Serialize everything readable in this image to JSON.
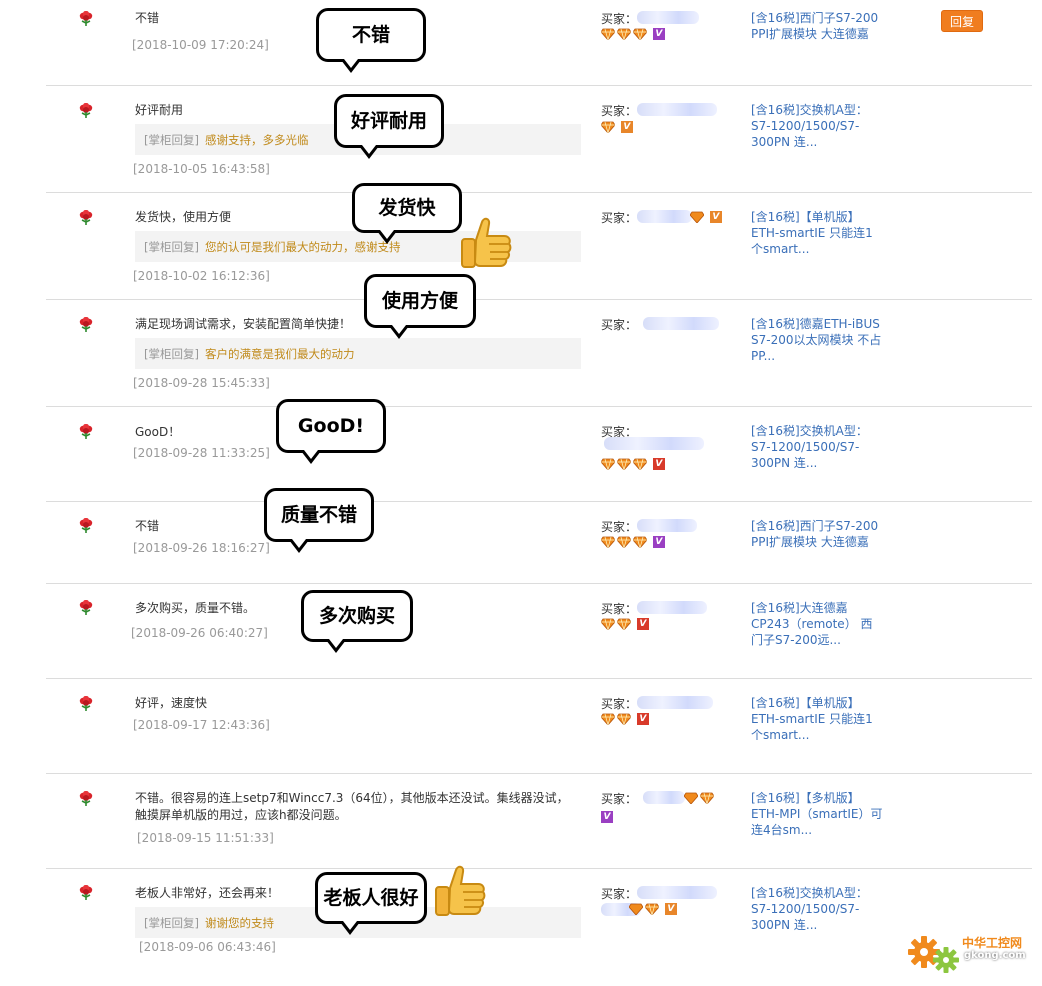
{
  "reviews": [
    {
      "comment": "不错",
      "reply_prefix": "",
      "reply_text": "",
      "date": "[2018-10-09 17:20:24]",
      "buyer_label": "买家：",
      "product": "[含16税]西门子S7-200 PPI扩展模块 大连德嘉",
      "has_reply_button": true,
      "reply_button_label": "回复"
    },
    {
      "comment": "好评耐用",
      "reply_prefix": "[掌柜回复]",
      "reply_text": "感谢支持，多多光临",
      "date": "[2018-10-05 16:43:58]",
      "buyer_label": "买家：",
      "product": "[含16税]交换机A型：S7-1200/1500/S7-300PN 连..."
    },
    {
      "comment": "发货快，使用方便",
      "reply_prefix": "[掌柜回复]",
      "reply_text": "您的认可是我们最大的动力，感谢支持",
      "date": "[2018-10-02 16:12:36]",
      "buyer_label": "买家：",
      "product": "[含16税]【单机版】ETH-smartIE 只能连1个smart..."
    },
    {
      "comment": "满足现场调试需求，安装配置简单快捷！",
      "reply_prefix": "[掌柜回复]",
      "reply_text": "客户的满意是我们最大的动力",
      "date": "[2018-09-28 15:45:33]",
      "buyer_label": "买家：",
      "product": "[含16税]德嘉ETH-iBUS S7-200以太网模块 不占PP..."
    },
    {
      "comment": "GooD！",
      "reply_prefix": "",
      "reply_text": "",
      "date": "[2018-09-28 11:33:25]",
      "buyer_label": "买家：",
      "product": "[含16税]交换机A型：S7-1200/1500/S7-300PN 连..."
    },
    {
      "comment": "不错",
      "reply_prefix": "",
      "reply_text": "",
      "date": "[2018-09-26 18:16:27]",
      "buyer_label": "买家：",
      "product": "[含16税]西门子S7-200 PPI扩展模块 大连德嘉"
    },
    {
      "comment": "多次购买，质量不错。",
      "reply_prefix": "",
      "reply_text": "",
      "date": "[2018-09-26 06:40:27]",
      "buyer_label": "买家：",
      "product": "[含16税]大连德嘉CP243（remote） 西门子S7-200远..."
    },
    {
      "comment": "好评，速度快",
      "reply_prefix": "",
      "reply_text": "",
      "date": "[2018-09-17 12:43:36]",
      "buyer_label": "买家：",
      "product": "[含16税]【单机版】ETH-smartIE 只能连1个smart..."
    },
    {
      "comment": "不错。很容易的连上setp7和Wincc7.3（64位），其他版本还没试。集线器没试，触摸屏单机版的用过，应该h都没问题。",
      "reply_prefix": "",
      "reply_text": "",
      "date": "[2018-09-15 11:51:33]",
      "buyer_label": "买家：",
      "product": "[含16税]【多机版】ETH-MPI（smartIE）可连4台sm..."
    },
    {
      "comment": "老板人非常好，还会再来！",
      "reply_prefix": "[掌柜回复]",
      "reply_text": "谢谢您的支持",
      "date": "[2018-09-06 06:43:46]",
      "buyer_label": "买家：",
      "product": "[含16税]交换机A型：S7-1200/1500/S7-300PN 连..."
    }
  ],
  "bubbles": [
    "不错",
    "好评耐用",
    "发货快",
    "使用方便",
    "GooD!",
    "质量不错",
    "多次购买",
    "老板人很好"
  ],
  "watermark": {
    "title": "中华工控网",
    "url": "gkong.com"
  },
  "colors": {
    "link": "#3a6fb8",
    "reply_text": "#c08a1a",
    "date": "#999999",
    "reply_button": "#f07d1f",
    "flower": "#d8232a"
  }
}
